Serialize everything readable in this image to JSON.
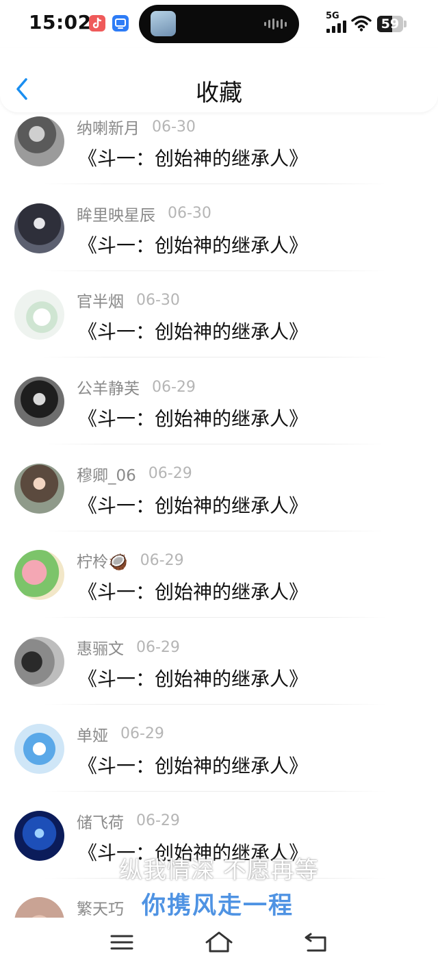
{
  "status_bar": {
    "time": "15:02",
    "network": "5G",
    "battery": "59",
    "battery_fraction": 0.59,
    "app_icons": [
      "douyin-icon",
      "screen-mirror-icon"
    ]
  },
  "header": {
    "title": "收藏",
    "back_icon": "chevron-left-icon",
    "accent_color": "#1a8ef0"
  },
  "favorites": [
    {
      "name": "纳喇新月",
      "date": "06-30",
      "work": "《斗一：创始神的继承人》"
    },
    {
      "name": "眸里映星辰",
      "date": "06-30",
      "work": "《斗一：创始神的继承人》"
    },
    {
      "name": "官半烟",
      "date": "06-30",
      "work": "《斗一：创始神的继承人》"
    },
    {
      "name": "公羊静芙",
      "date": "06-29",
      "work": "《斗一：创始神的继承人》"
    },
    {
      "name": "穆卿_06",
      "date": "06-29",
      "work": "《斗一：创始神的继承人》"
    },
    {
      "name": "柠柃🥥",
      "date": "06-29",
      "work": "《斗一：创始神的继承人》"
    },
    {
      "name": "惠骊文",
      "date": "06-29",
      "work": "《斗一：创始神的继承人》"
    },
    {
      "name": "单娅",
      "date": "06-29",
      "work": "《斗一：创始神的继承人》"
    },
    {
      "name": "储飞荷",
      "date": "06-29",
      "work": "《斗一：创始神的继承人》"
    },
    {
      "name": "繁天巧",
      "date": "",
      "work": ""
    }
  ],
  "subtitles": {
    "line1": "纵我情深 不愿再等",
    "line2": "你携风走一程"
  },
  "navbar": {
    "icons": [
      "menu-icon",
      "home-icon",
      "back-icon"
    ]
  }
}
